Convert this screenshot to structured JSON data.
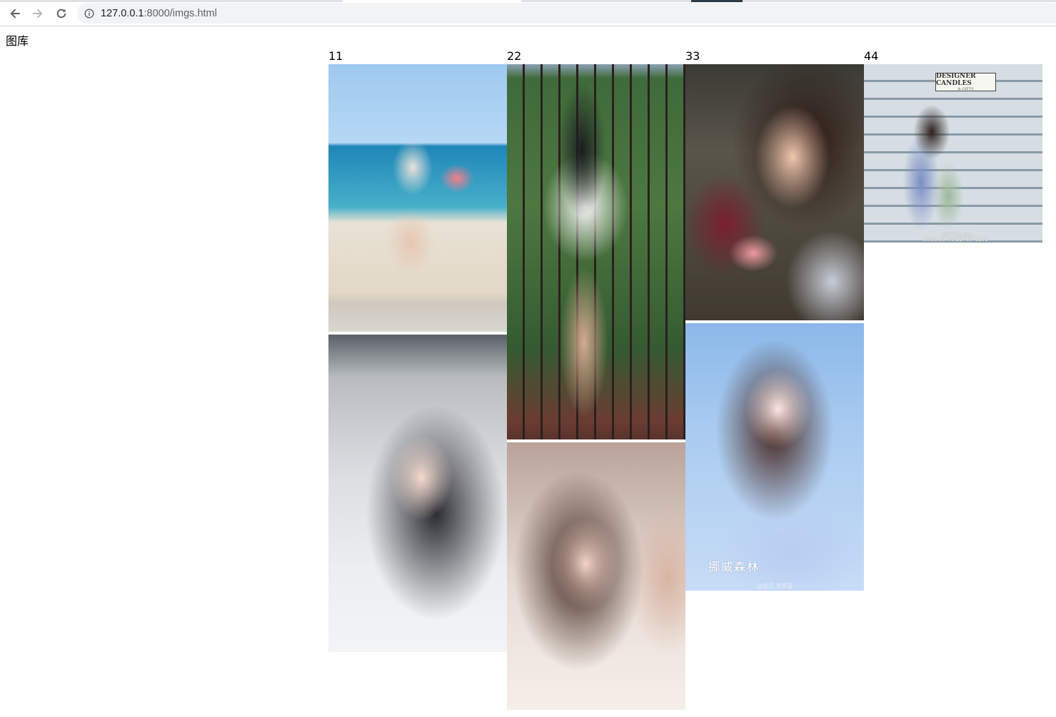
{
  "browser": {
    "url_host": "127.0.0.1",
    "url_path": ":8000/imgs.html",
    "back_icon": "arrow-left-icon",
    "forward_icon": "arrow-right-icon",
    "reload_icon": "reload-icon",
    "site_info_icon": "info-circle-icon"
  },
  "page": {
    "title": "图库",
    "columns": [
      {
        "label": "11",
        "photos": [
          {
            "subject": "beach"
          },
          {
            "subject": "portrait"
          }
        ]
      },
      {
        "label": "22",
        "photos": [
          {
            "subject": "railing"
          },
          {
            "subject": "portrait"
          }
        ]
      },
      {
        "label": "33",
        "photos": [
          {
            "subject": "flowers"
          },
          {
            "subject": "blue-portrait",
            "caption": "挪威森林",
            "watermark": "@初见·张爱嘉"
          }
        ]
      },
      {
        "label": "44",
        "photos": [
          {
            "subject": "shop",
            "sign_title": "DESIGNER CANDLES",
            "sign_subtitle": "& GIFTS",
            "watermark1": "@安安Janice",
            "watermark2": "weibo.com/u/2278571251"
          }
        ]
      }
    ]
  }
}
